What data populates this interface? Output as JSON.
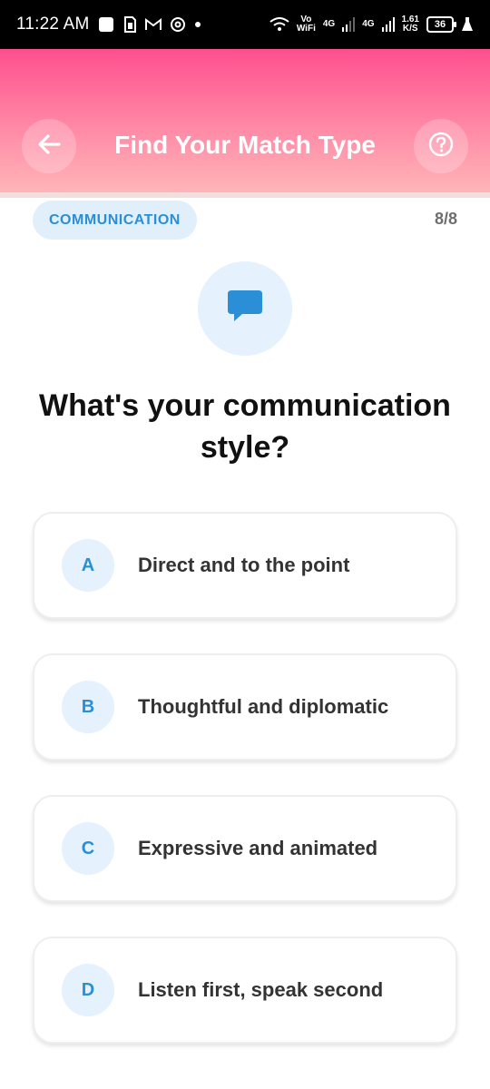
{
  "status_bar": {
    "time": "11:22 AM",
    "icons": [
      "square-icon",
      "sim-icon",
      "gmail-icon",
      "threads-icon",
      "dot-icon"
    ],
    "vo_wifi_top": "Vo",
    "vo_wifi_bottom": "WiFi",
    "network1": "4G",
    "network2": "4G",
    "speed_top": "1.61",
    "speed_bottom": "K/S",
    "battery": "36"
  },
  "header": {
    "title": "Find Your Match Type",
    "gradient_start": "#ff4f8e",
    "gradient_end": "#ffb6b9"
  },
  "quiz": {
    "category": "COMMUNICATION",
    "progress": "8/8",
    "icon": "chat-bubble-icon",
    "question": "What's your communication style?",
    "accent_color": "#2a8fd6",
    "options": [
      {
        "letter": "A",
        "text": "Direct and to the point"
      },
      {
        "letter": "B",
        "text": "Thoughtful and diplomatic"
      },
      {
        "letter": "C",
        "text": "Expressive and animated"
      },
      {
        "letter": "D",
        "text": "Listen first, speak second"
      }
    ]
  }
}
